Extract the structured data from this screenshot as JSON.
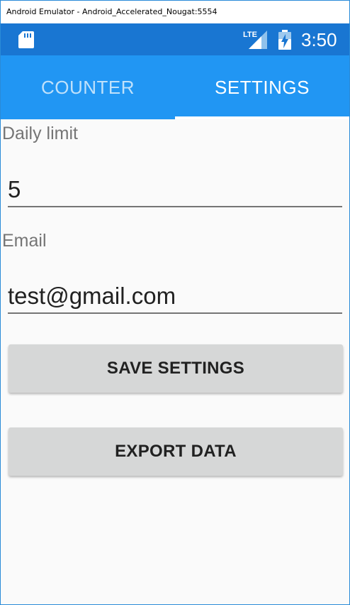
{
  "window": {
    "title": "Android Emulator - Android_Accelerated_Nougat:5554"
  },
  "status_bar": {
    "network_label": "LTE",
    "time": "3:50",
    "icons": [
      "sd-card-icon",
      "lte-signal-icon",
      "battery-charging-icon"
    ],
    "background_color": "#1976d2"
  },
  "tabs": {
    "items": [
      {
        "label": "COUNTER",
        "selected": false
      },
      {
        "label": "SETTINGS",
        "selected": true
      }
    ],
    "background_color": "#2196f3"
  },
  "form": {
    "daily_limit": {
      "label": "Daily limit",
      "value": "5"
    },
    "email": {
      "label": "Email",
      "value": "test@gmail.com"
    }
  },
  "actions": {
    "save_label": "SAVE SETTINGS",
    "export_label": "EXPORT DATA"
  }
}
